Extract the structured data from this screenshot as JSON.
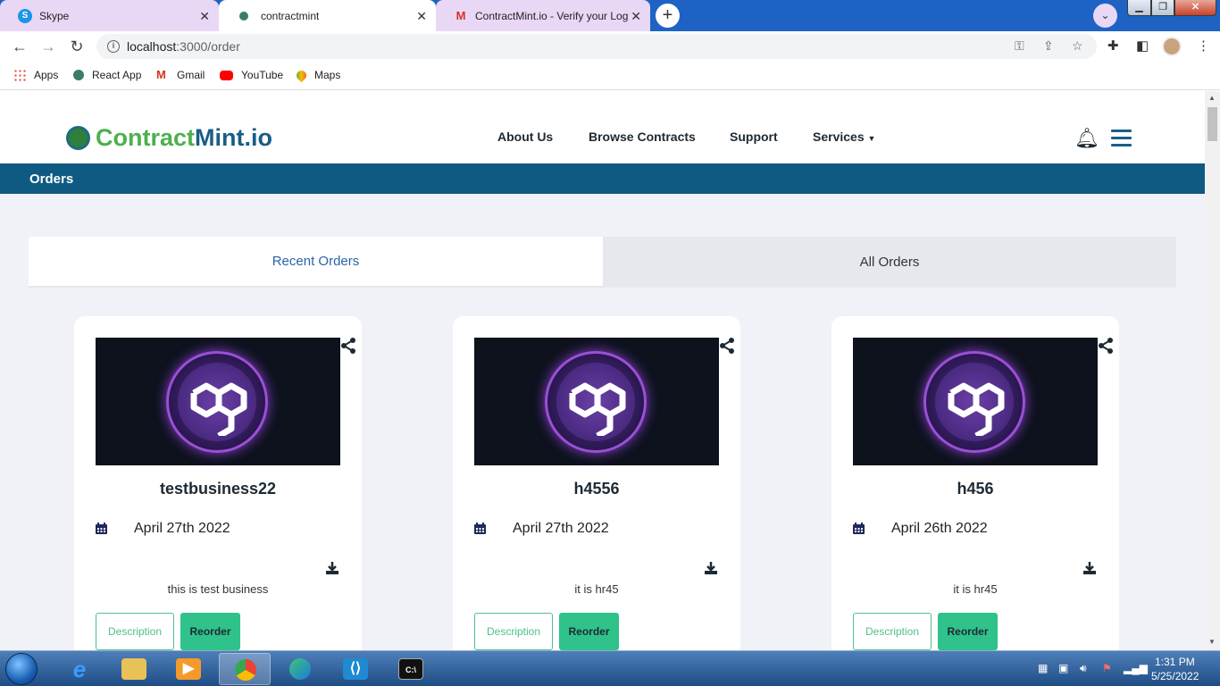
{
  "browser": {
    "tabs": [
      {
        "title": "Skype",
        "icon": "skype-icon",
        "color": "#1e94e8"
      },
      {
        "title": "contractmint",
        "icon": "contractmint-favicon",
        "color": "#3a7c6a"
      },
      {
        "title": "ContractMint.io - Verify your Log",
        "icon": "gmail-icon",
        "color": "#d93025"
      }
    ],
    "url_host": "localhost",
    "url_path": ":3000/order",
    "bookmarks": [
      {
        "label": "Apps",
        "icon": "apps-grid-icon"
      },
      {
        "label": "React App",
        "icon": "react-app-icon"
      },
      {
        "label": "Gmail",
        "icon": "gmail-icon"
      },
      {
        "label": "YouTube",
        "icon": "youtube-icon"
      },
      {
        "label": "Maps",
        "icon": "maps-icon"
      }
    ]
  },
  "site": {
    "logo_part1": "Contract",
    "logo_part2": "Mint.io",
    "nav": {
      "about": "About Us",
      "browse": "Browse Contracts",
      "support": "Support",
      "services": "Services"
    },
    "section_title": "Orders",
    "tabs": {
      "recent": "Recent Orders",
      "all": "All Orders",
      "active": "recent"
    },
    "brand_color": "#0f5a82",
    "accent_green": "#2fc28a"
  },
  "orders": [
    {
      "title": "testbusiness22",
      "date": "April 27th 2022",
      "description": "this is test business",
      "desc_btn": "Description",
      "reorder_btn": "Reorder"
    },
    {
      "title": "h4556",
      "date": "April 27th 2022",
      "description": "it is hr45",
      "desc_btn": "Description",
      "reorder_btn": "Reorder"
    },
    {
      "title": "h456",
      "date": "April 26th 2022",
      "description": "it is hr45",
      "desc_btn": "Description",
      "reorder_btn": "Reorder"
    }
  ],
  "taskbar": {
    "apps": [
      {
        "name": "internet-explorer-icon"
      },
      {
        "name": "file-explorer-icon"
      },
      {
        "name": "media-player-icon"
      },
      {
        "name": "chrome-icon",
        "active": true
      },
      {
        "name": "edge-icon"
      },
      {
        "name": "vscode-icon"
      },
      {
        "name": "cmd-icon"
      }
    ],
    "time": "1:31 PM",
    "date": "5/25/2022"
  }
}
